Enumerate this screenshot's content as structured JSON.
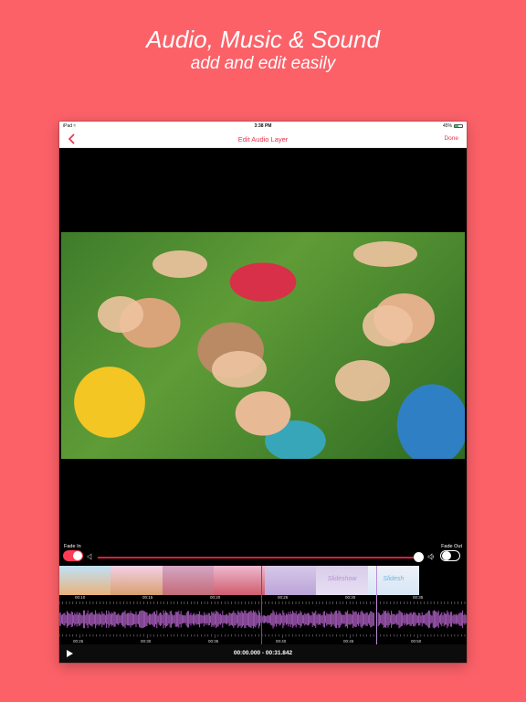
{
  "headline": {
    "line1": "Audio, Music & Sound",
    "line2": "add and edit easily"
  },
  "statusbar": {
    "device": "iPad",
    "time": "3:38 PM",
    "battery": "45%"
  },
  "navbar": {
    "title": "Edit Audio Layer",
    "done_label": "Done"
  },
  "fade": {
    "in_label": "Fade In",
    "in_on": true,
    "out_label": "Fade Out",
    "out_on": false,
    "volume": 0.97
  },
  "filmstrip": {
    "frames": [
      {
        "kind": "photo",
        "colors": [
          "#bfe2f7",
          "#e9b27c"
        ]
      },
      {
        "kind": "photo",
        "colors": [
          "#f3d1e7",
          "#d8a06f"
        ]
      },
      {
        "kind": "photo",
        "colors": [
          "#d4a6c4",
          "#c46b78"
        ]
      },
      {
        "kind": "photo",
        "colors": [
          "#efb8cf",
          "#cf5d6e"
        ]
      },
      {
        "kind": "title",
        "colors": [
          "#d7c8e8",
          "#bba4d8"
        ],
        "text": ""
      },
      {
        "kind": "title",
        "colors": [
          "#d9cdea",
          "#e7def2"
        ],
        "text": "Slideshow"
      },
      {
        "kind": "title",
        "colors": [
          "#eef1f8",
          "#d6e6f5"
        ],
        "text": "Slidesh"
      }
    ]
  },
  "ruler_top": [
    "00:10",
    "00:15",
    "00:20",
    "00:25",
    "00:30",
    "00:35"
  ],
  "ruler_bottom": [
    "00:25",
    "00:30",
    "00:35",
    "00:40",
    "00:45",
    "00:50"
  ],
  "timecode": "00:00.000 - 00:31.842",
  "colors": {
    "accent": "#e6334b",
    "wave": "#a45ab8",
    "background": "#fc6168"
  }
}
